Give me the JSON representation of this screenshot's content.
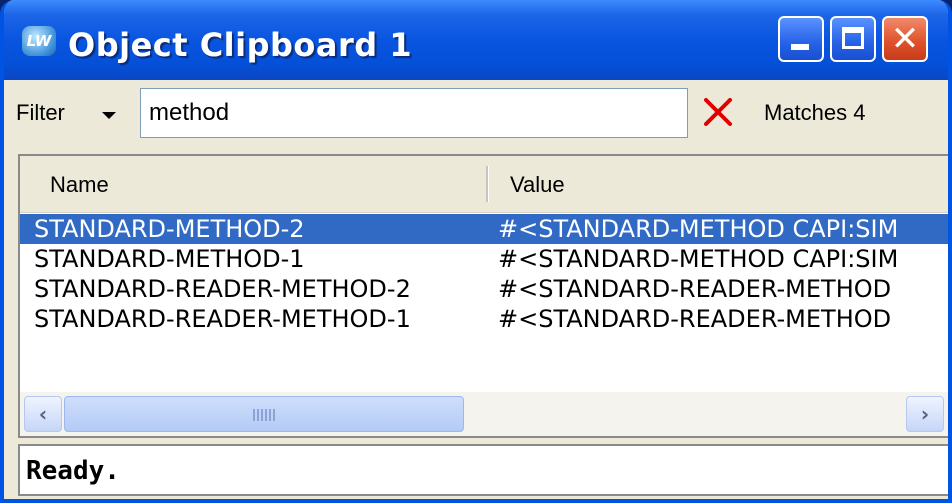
{
  "window": {
    "title": "Object Clipboard 1",
    "app_icon_text": "LW"
  },
  "filter": {
    "label": "Filter",
    "value": "method",
    "matches_text": "Matches 4"
  },
  "list": {
    "columns": {
      "name": "Name",
      "value": "Value"
    },
    "rows": [
      {
        "name": "STANDARD-METHOD-2",
        "value": "#<STANDARD-METHOD CAPI:SIM",
        "selected": true
      },
      {
        "name": "STANDARD-METHOD-1",
        "value": "#<STANDARD-METHOD CAPI:SIM",
        "selected": false
      },
      {
        "name": "STANDARD-READER-METHOD-2",
        "value": "#<STANDARD-READER-METHOD",
        "selected": false
      },
      {
        "name": "STANDARD-READER-METHOD-1",
        "value": "#<STANDARD-READER-METHOD",
        "selected": false
      }
    ]
  },
  "status": {
    "text": "Ready."
  },
  "colors": {
    "selection": "#316ac5",
    "title_bar": "#0a55e0",
    "clear_x": "#e00000"
  },
  "icons": {
    "app": "lispworks-icon",
    "minimize": "minimize-icon",
    "maximize": "maximize-icon",
    "close": "close-icon",
    "clear": "clear-x-icon",
    "dropdown": "caret-down-icon"
  }
}
